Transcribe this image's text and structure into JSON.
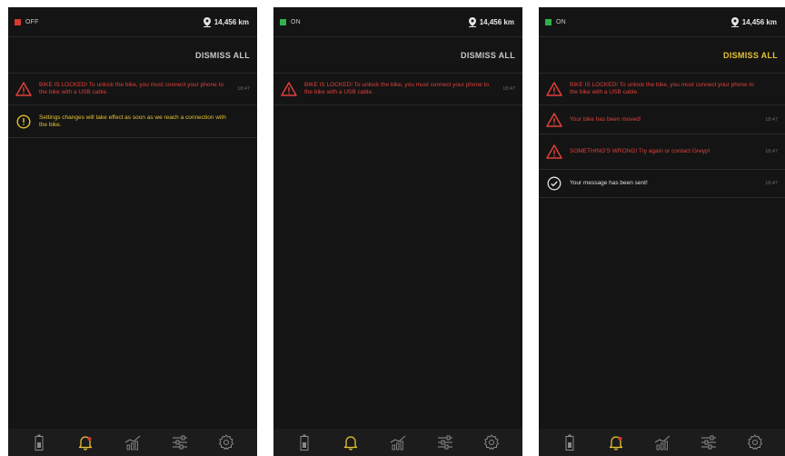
{
  "colors": {
    "screen_bg": "#141414",
    "alert_red": "#e0403a",
    "warning_yellow": "#e6c234",
    "success_white": "#e0e0e0",
    "status_off": "#d63a2f",
    "status_on": "#2fb24a",
    "active_tab": "#e6c234"
  },
  "screens": [
    {
      "status": {
        "text": "OFF",
        "indicator": "red"
      },
      "odometer": "14,456 km",
      "dismiss_all": "DISMISS ALL",
      "notifications": [
        {
          "type": "alert",
          "icon": "warning-triangle-icon",
          "text": "BIKE IS LOCKED! To unlock the bike, you must connect your phone to the bike with a USB cable.",
          "time": "18:47"
        },
        {
          "type": "info",
          "icon": "info-circle-icon",
          "text": "Settings changes will take effect as soon as we reach a connection with the bike.",
          "time": ""
        }
      ]
    },
    {
      "status": {
        "text": "ON",
        "indicator": "green"
      },
      "odometer": "14,456 km",
      "dismiss_all": "DISMISS ALL",
      "notifications": [
        {
          "type": "alert",
          "icon": "warning-triangle-icon",
          "text": "BIKE IS LOCKED! To unlock the bike, you must connect your phone to the bike with a USB cable.",
          "time": "18:47"
        }
      ]
    },
    {
      "status": {
        "text": "ON",
        "indicator": "green"
      },
      "odometer": "14,456 km",
      "dismiss_all": "DISMISS ALL",
      "notifications": [
        {
          "type": "alert",
          "icon": "warning-triangle-icon",
          "text": "BIKE IS LOCKED! To unlock the bike, you must connect your phone to the bike with a USB cable.",
          "time": ""
        },
        {
          "type": "alert",
          "icon": "warning-triangle-icon",
          "text": "Your bike has been moved!",
          "time": "18:47"
        },
        {
          "type": "alert",
          "icon": "warning-triangle-icon",
          "text": "SOMETHING'S WRONG! Try again or contact Greyp!",
          "time": "18:47"
        },
        {
          "type": "success",
          "icon": "check-circle-icon",
          "text": "Your message has been sent!",
          "time": "18:47"
        }
      ]
    }
  ],
  "tabs": [
    {
      "icon": "battery-icon"
    },
    {
      "icon": "bell-icon",
      "active": true,
      "badge": "!"
    },
    {
      "icon": "stats-chart-icon"
    },
    {
      "icon": "sliders-icon"
    },
    {
      "icon": "gear-icon"
    }
  ]
}
